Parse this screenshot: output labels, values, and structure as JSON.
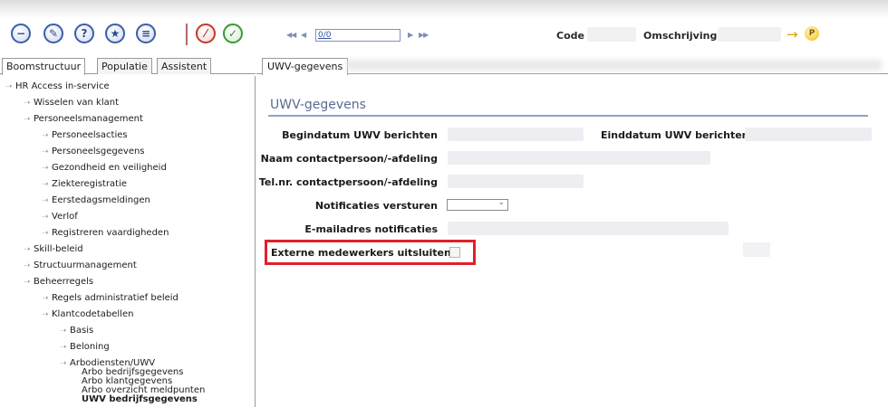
{
  "toolbar": {
    "icons": [
      "minus-circle-icon",
      "pin-icon",
      "help-icon",
      "star-icon",
      "list-icon",
      "edit-icon",
      "check-icon"
    ],
    "nav_value": "0/0",
    "code_label": "Code",
    "description_label": "Omschrijving"
  },
  "left_tabs": [
    "Boomstructuur",
    "Populatie",
    "Assistent"
  ],
  "tree": [
    {
      "label": "HR Access in-service",
      "level": 0
    },
    {
      "label": "Wisselen van klant",
      "level": 1
    },
    {
      "label": "Personeelsmanagement",
      "level": 1
    },
    {
      "label": "Personeelsacties",
      "level": 2
    },
    {
      "label": "Personeelsgegevens",
      "level": 2
    },
    {
      "label": "Gezondheid en veiligheid",
      "level": 2
    },
    {
      "label": "Ziekteregistratie",
      "level": 2
    },
    {
      "label": "Eerstedagsmeldingen",
      "level": 2
    },
    {
      "label": "Verlof",
      "level": 2
    },
    {
      "label": "Registreren vaardigheden",
      "level": 2
    },
    {
      "label": "Skill-beleid",
      "level": 1
    },
    {
      "label": "Structuurmanagement",
      "level": 1
    },
    {
      "label": "Beheerregels",
      "level": 1
    },
    {
      "label": "Regels administratief beleid",
      "level": 2
    },
    {
      "label": "Klantcodetabellen",
      "level": 2
    },
    {
      "label": "Basis",
      "level": 3
    },
    {
      "label": "Beloning",
      "level": 3
    },
    {
      "label": "Arbodiensten/UWV",
      "level": 3
    }
  ],
  "tree_leaves": [
    {
      "label": "Arbo bedrijfsgegevens",
      "bold": false
    },
    {
      "label": "Arbo klantgegevens",
      "bold": false
    },
    {
      "label": "Arbo overzicht meldpunten",
      "bold": false
    },
    {
      "label": "UWV bedrijfsgegevens",
      "bold": true
    }
  ],
  "right_tab": "UWV-gegevens",
  "section_title": "UWV-gegevens",
  "fields": {
    "begindatum": "Begindatum UWV berichten",
    "einddatum": "Einddatum UWV berichten",
    "naam_contact": "Naam contactpersoon/-afdeling",
    "telnr_contact": "Tel.nr. contactpersoon/-afdeling",
    "notificaties": "Notificaties versturen",
    "email": "E-mailadres notificaties",
    "externe": "Externe medewerkers uitsluiten"
  },
  "colors": {
    "highlight": "#e0202a",
    "section_title": "#5a6d90",
    "toolbar_icon": "#3b5ea8"
  }
}
